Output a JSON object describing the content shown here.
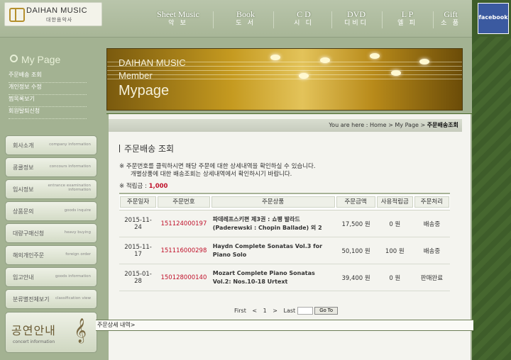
{
  "header": {
    "logo_text": "DAIHAN MUSIC",
    "logo_sub": "대한음악사",
    "nav": [
      {
        "en": "Sheet Music",
        "ko": "악 보"
      },
      {
        "en": "Book",
        "ko": "도 서"
      },
      {
        "en": "C D",
        "ko": "시 디"
      },
      {
        "en": "DVD",
        "ko": "디비디"
      },
      {
        "en": "L P",
        "ko": "엘 피"
      },
      {
        "en": "Gift",
        "ko": "소 품"
      }
    ],
    "facebook_label": "facebook"
  },
  "sidebar": {
    "title": "My Page",
    "menu": [
      "주문배송 조회",
      "개인정보 수정",
      "찜목록보기",
      "회원탈퇴신청"
    ],
    "buttons": [
      {
        "ko": "회사소개",
        "en": "company information"
      },
      {
        "ko": "콩쿨정보",
        "en": "concours information"
      },
      {
        "ko": "입시정보",
        "en": "entrance examination information"
      },
      {
        "ko": "상품문의",
        "en": "goods inquire"
      },
      {
        "ko": "대량구매신청",
        "en": "heavy buying"
      },
      {
        "ko": "해외개인주문",
        "en": "foreign order"
      },
      {
        "ko": "입고안내",
        "en": "goods information"
      },
      {
        "ko": "분류별전체보기",
        "en": "classification view"
      }
    ],
    "concert": {
      "ko": "공연안내",
      "en": "concert information"
    }
  },
  "banner": {
    "line1": "DAIHAN MUSIC",
    "line2": "Member",
    "line3": "Mypage"
  },
  "breadcrumb": {
    "prefix": "You are here : Home > My Page > ",
    "current": "주문배송조회"
  },
  "page": {
    "title": "주문배송 조회",
    "note1": "※ 주문번호를 클릭하시면 해당 주문에 대한 상세내역을 확인하실 수 있습니다.",
    "note2": "개별상품에 대한 배송조회는 상세내역에서 확인하시기 바랍니다.",
    "points_label": "※ 적립금 : ",
    "points_value": "1,000"
  },
  "table": {
    "headers": [
      "주문일자",
      "주문번호",
      "주문상품",
      "주문금액",
      "사용적립금",
      "주문처리"
    ],
    "rows": [
      {
        "date": "2015-11-24",
        "order_no": "151124000197",
        "product": "파데레프스키편 제3권 : 쇼팽 발라드 (Paderewski : Chopin Ballade) 외 2",
        "amount": "17,500 원",
        "points": "0 원",
        "status": "배송중"
      },
      {
        "date": "2015-11-17",
        "order_no": "151116000298",
        "product": "Haydn Complete Sonatas Vol.3 for Piano Solo",
        "amount": "50,100 원",
        "points": "100 원",
        "status": "배송중"
      },
      {
        "date": "2015-01-28",
        "order_no": "150128000140",
        "product": "Mozart Complete Piano Sonatas Vol.2: Nos.10-18 Urtext",
        "amount": "39,400 원",
        "points": "0 원",
        "status": "판매완료"
      }
    ]
  },
  "pager": {
    "first": "First",
    "prev": "<",
    "page": "1",
    "next": ">",
    "last": "Last",
    "go": "Go To"
  },
  "status_bar": "주문상세 내역>"
}
